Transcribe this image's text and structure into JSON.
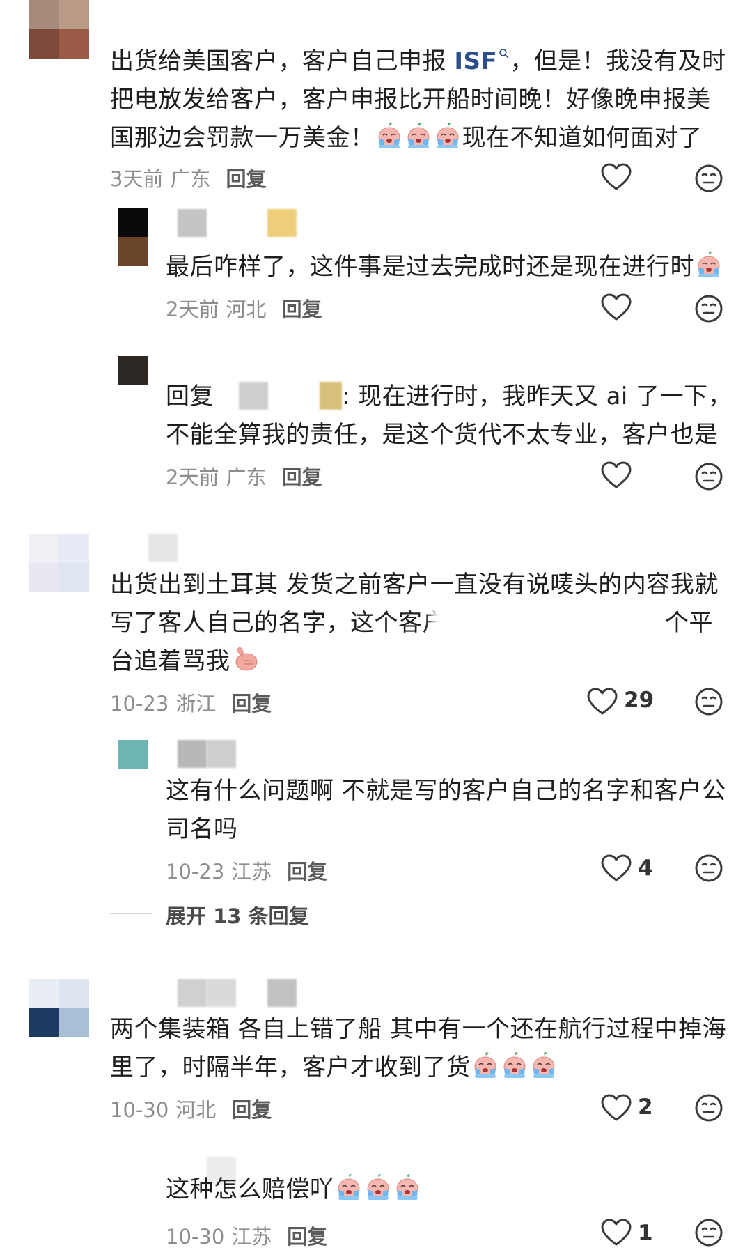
{
  "comments": [
    {
      "line1_a": "出货给美国客户，客户自己申报 ",
      "line1_link": "ISF",
      "line1_b": "，但是！我没有及时",
      "line2": "把电放发给客户，客户申报比开船时间晚！好像晚申报美",
      "line3_a": "国那边会罚款一万美金！",
      "line3_b": "现在不知道如何面对了",
      "time": "3天前",
      "region": "广东",
      "reply": "回复"
    },
    {
      "line1": "最后咋样了，这件事是过去完成时还是现在进行时",
      "time": "2天前",
      "region": "河北",
      "reply": "回复"
    },
    {
      "line1_prefix": "回复",
      "line1_rest": ": 现在进行时，我昨天又 ai 了一下，",
      "line2": "不能全算我的责任，是这个货代不太专业，客户也是",
      "time": "2天前",
      "region": "广东",
      "reply": "回复"
    },
    {
      "line1": "出货出到土耳其 发货之前客户一直没有说唛头的内容我就",
      "line2_a": "写了客人自己的名字，这个客户",
      "line2_b": "个平",
      "line3": "台追着骂我",
      "time": "10-23",
      "region": "浙江",
      "reply": "回复",
      "likes": "29"
    },
    {
      "line1": "这有什么问题啊 不就是写的客户自己的名字和客户公",
      "line2": "司名吗",
      "time": "10-23",
      "region": "江苏",
      "reply": "回复",
      "likes": "4"
    },
    {
      "line1": "两个集装箱 各自上错了船 其中有一个还在航行过程中掉海",
      "line2": "里了，时隔半年，客户才收到了货",
      "time": "10-30",
      "region": "河北",
      "reply": "回复",
      "likes": "2"
    },
    {
      "line1": "这种怎么赔偿吖",
      "time": "10-30",
      "region": "江苏",
      "reply": "回复",
      "likes": "1"
    }
  ],
  "expand": {
    "label": "展开 13 条回复"
  },
  "icons": {
    "like": "heart-outline-icon",
    "dislike": "neutral-face-icon",
    "search": "search-icon",
    "cry": "crying-emoji-icon",
    "thumb": "thumbs-up-emoji-icon"
  },
  "colors": {
    "link": "#2c4f8c",
    "meta": "#8d8d8d",
    "reply": "#5b5b5b"
  }
}
